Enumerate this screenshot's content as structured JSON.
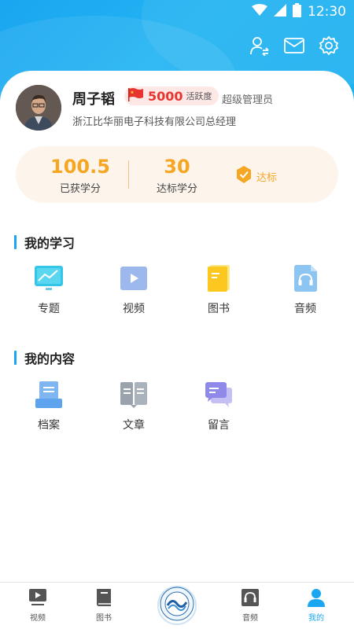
{
  "status_bar": {
    "time": "12:30"
  },
  "profile": {
    "name": "周子韬",
    "points": "5000",
    "points_label": "活跃度",
    "role": "超级管理员",
    "company": "浙江比华丽电子科技有限公司总经理"
  },
  "scores": {
    "earned_value": "100.5",
    "earned_label": "已获学分",
    "target_value": "30",
    "target_label": "达标学分",
    "status_label": "达标"
  },
  "learning": {
    "title": "我的学习",
    "items": [
      {
        "label": "专题",
        "icon": "topic-icon"
      },
      {
        "label": "视频",
        "icon": "video-icon"
      },
      {
        "label": "图书",
        "icon": "book-icon"
      },
      {
        "label": "音频",
        "icon": "audio-icon"
      }
    ]
  },
  "content": {
    "title": "我的内容",
    "items": [
      {
        "label": "档案",
        "icon": "archive-icon"
      },
      {
        "label": "文章",
        "icon": "article-icon"
      },
      {
        "label": "留言",
        "icon": "message-icon"
      }
    ]
  },
  "bottom_nav": {
    "items": [
      {
        "label": "视频",
        "icon": "video-nav-icon"
      },
      {
        "label": "图书",
        "icon": "book-nav-icon"
      },
      {
        "label": "",
        "icon": "center-logo-icon"
      },
      {
        "label": "音频",
        "icon": "audio-nav-icon"
      },
      {
        "label": "我的",
        "icon": "me-nav-icon",
        "active": true
      }
    ]
  },
  "colors": {
    "accent": "#1aa6f0",
    "score": "#f5a623",
    "points": "#e8342f"
  }
}
